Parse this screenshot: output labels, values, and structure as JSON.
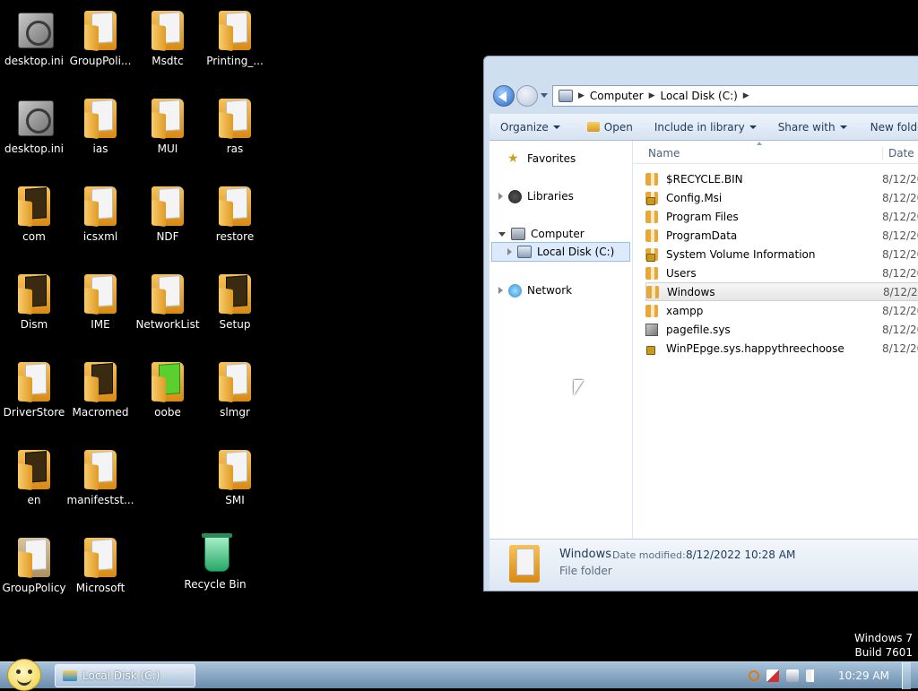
{
  "desktop": {
    "icons": [
      {
        "label": "desktop.ini",
        "icon": "ini-file-icon"
      },
      {
        "label": "GroupPoli...",
        "icon": "folder-icon"
      },
      {
        "label": "Msdtc",
        "icon": "folder-icon"
      },
      {
        "label": "Printing_...",
        "icon": "folder-icon"
      },
      {
        "label": "desktop.ini",
        "icon": "ini-file-icon"
      },
      {
        "label": "ias",
        "icon": "folder-icon"
      },
      {
        "label": "MUI",
        "icon": "folder-icon"
      },
      {
        "label": "ras",
        "icon": "folder-icon"
      },
      {
        "label": "com",
        "icon": "folder-icon"
      },
      {
        "label": "icsxml",
        "icon": "folder-icon"
      },
      {
        "label": "NDF",
        "icon": "folder-icon"
      },
      {
        "label": "restore",
        "icon": "folder-icon"
      },
      {
        "label": "Dism",
        "icon": "folder-icon"
      },
      {
        "label": "IME",
        "icon": "folder-icon"
      },
      {
        "label": "NetworkList",
        "icon": "folder-icon"
      },
      {
        "label": "Setup",
        "icon": "folder-icon"
      },
      {
        "label": "DriverStore",
        "icon": "folder-icon"
      },
      {
        "label": "Macromed",
        "icon": "folder-icon"
      },
      {
        "label": "oobe",
        "icon": "folder-icon"
      },
      {
        "label": "slmgr",
        "icon": "folder-icon"
      },
      {
        "label": "en",
        "icon": "folder-icon"
      },
      {
        "label": "manifestst...",
        "icon": "folder-icon"
      },
      {
        "label": "SMI",
        "icon": "folder-icon"
      },
      {
        "label": "GroupPolicy",
        "icon": "folder-icon"
      },
      {
        "label": "Microsoft",
        "icon": "folder-icon"
      },
      {
        "label": "Recycle Bin",
        "icon": "recycle-bin-icon"
      }
    ],
    "watermark": {
      "line1": "Windows 7",
      "line2": "Build 7601"
    }
  },
  "explorer": {
    "breadcrumb": [
      "Computer",
      "Local Disk (C:)"
    ],
    "toolbar": {
      "organize": "Organize",
      "open": "Open",
      "include": "Include in library",
      "share": "Share with",
      "new_folder": "New folder"
    },
    "nav": {
      "favorites": "Favorites",
      "libraries": "Libraries",
      "computer": "Computer",
      "local_disk": "Local Disk (C:)",
      "network": "Network"
    },
    "columns": {
      "name": "Name",
      "date": "Date mo"
    },
    "files": [
      {
        "name": "$RECYCLE.BIN",
        "date": "8/12/20",
        "icon": "folder-icon"
      },
      {
        "name": "Config.Msi",
        "date": "8/12/20",
        "icon": "locked-folder-icon"
      },
      {
        "name": "Program Files",
        "date": "8/12/20",
        "icon": "folder-icon"
      },
      {
        "name": "ProgramData",
        "date": "8/12/20",
        "icon": "folder-icon"
      },
      {
        "name": "System Volume Information",
        "date": "8/12/20",
        "icon": "locked-folder-icon"
      },
      {
        "name": "Users",
        "date": "8/12/20",
        "icon": "folder-icon"
      },
      {
        "name": "Windows",
        "date": "8/12/20",
        "icon": "folder-icon"
      },
      {
        "name": "xampp",
        "date": "8/12/20",
        "icon": "folder-icon"
      },
      {
        "name": "pagefile.sys",
        "date": "8/12/20",
        "icon": "system-file-icon"
      },
      {
        "name": "WinPEpge.sys.happythreechoose",
        "date": "8/12/20",
        "icon": "locked-file-icon"
      }
    ],
    "details": {
      "name": "Windows",
      "modified_label": "Date modified:",
      "modified_value": "8/12/2022 10:28 AM",
      "type": "File folder"
    }
  },
  "taskbar": {
    "task_label": "Local Disk (C:)",
    "clock": "10:29 AM"
  }
}
